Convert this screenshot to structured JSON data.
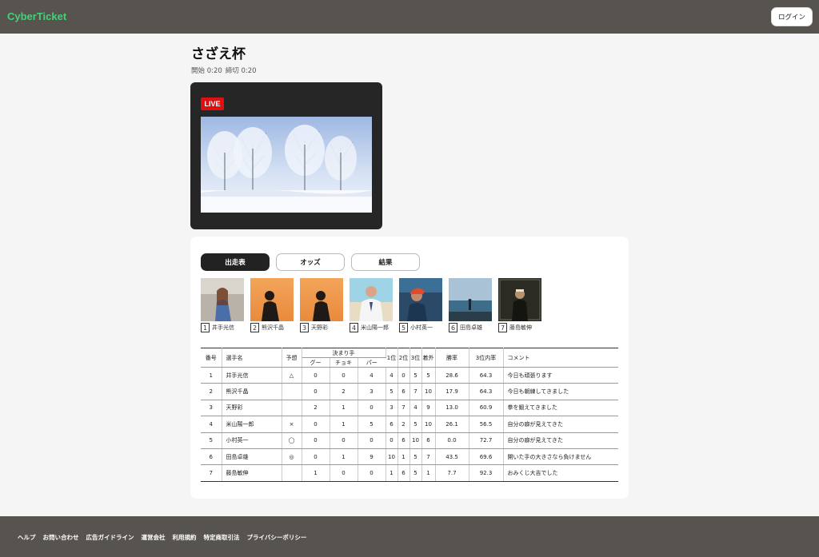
{
  "header": {
    "brand": "CyberTicket",
    "login_label": "ログイン"
  },
  "race": {
    "title": "さざえ杯",
    "start_label": "開始 0:20",
    "close_label": "締切 0:20"
  },
  "player": {
    "live_label": "LIVE"
  },
  "tabs": [
    {
      "label": "出走表",
      "active": true
    },
    {
      "label": "オッズ",
      "active": false
    },
    {
      "label": "結果",
      "active": false
    }
  ],
  "racers": [
    {
      "number": "1",
      "name": "井手光信"
    },
    {
      "number": "2",
      "name": "熊沢千晶"
    },
    {
      "number": "3",
      "name": "天野彩"
    },
    {
      "number": "4",
      "name": "米山陽一郎"
    },
    {
      "number": "5",
      "name": "小村英一"
    },
    {
      "number": "6",
      "name": "田島卓雄"
    },
    {
      "number": "7",
      "name": "藤島敏伸"
    }
  ],
  "table": {
    "headers": {
      "number": "番号",
      "name": "選手名",
      "prediction": "予想",
      "technique": "決まり手",
      "goo": "グー",
      "choki": "チョキ",
      "paa": "パー",
      "first": "1位",
      "second": "2位",
      "third": "3位",
      "out": "着外",
      "win_rate": "勝率",
      "top3_rate": "3位内率",
      "comment": "コメント"
    },
    "rows": [
      {
        "number": "1",
        "name": "井手光信",
        "prediction": "△",
        "goo": "0",
        "choki": "0",
        "paa": "4",
        "first": "4",
        "second": "0",
        "third": "5",
        "out": "5",
        "win_rate": "28.6",
        "top3_rate": "64.3",
        "comment": "今日も頑張ります"
      },
      {
        "number": "2",
        "name": "熊沢千晶",
        "prediction": "",
        "goo": "0",
        "choki": "2",
        "paa": "3",
        "first": "5",
        "second": "6",
        "third": "7",
        "out": "10",
        "win_rate": "17.9",
        "top3_rate": "64.3",
        "comment": "今日も朝練してきました"
      },
      {
        "number": "3",
        "name": "天野彩",
        "prediction": "",
        "goo": "2",
        "choki": "1",
        "paa": "0",
        "first": "3",
        "second": "7",
        "third": "4",
        "out": "9",
        "win_rate": "13.0",
        "top3_rate": "60.9",
        "comment": "拳を鍛えてきました"
      },
      {
        "number": "4",
        "name": "米山陽一郎",
        "prediction": "×",
        "goo": "0",
        "choki": "1",
        "paa": "5",
        "first": "6",
        "second": "2",
        "third": "5",
        "out": "10",
        "win_rate": "26.1",
        "top3_rate": "56.5",
        "comment": "自分の癖が見えてきた"
      },
      {
        "number": "5",
        "name": "小村英一",
        "prediction": "◯",
        "goo": "0",
        "choki": "0",
        "paa": "0",
        "first": "0",
        "second": "6",
        "third": "10",
        "out": "6",
        "win_rate": "0.0",
        "top3_rate": "72.7",
        "comment": "自分の癖が見えてきた"
      },
      {
        "number": "6",
        "name": "田島卓雄",
        "prediction": "◎",
        "goo": "0",
        "choki": "1",
        "paa": "9",
        "first": "10",
        "second": "1",
        "third": "5",
        "out": "7",
        "win_rate": "43.5",
        "top3_rate": "69.6",
        "comment": "開いた手の大きさなら負けません"
      },
      {
        "number": "7",
        "name": "藤島敏伸",
        "prediction": "",
        "goo": "1",
        "choki": "0",
        "paa": "0",
        "first": "1",
        "second": "6",
        "third": "5",
        "out": "1",
        "win_rate": "7.7",
        "top3_rate": "92.3",
        "comment": "おみくじ大吉でした"
      }
    ]
  },
  "footer": {
    "links": [
      "ヘルプ",
      "お問い合わせ",
      "広告ガイドライン",
      "運営会社",
      "利用規約",
      "特定商取引法",
      "プライバシーポリシー"
    ]
  }
}
